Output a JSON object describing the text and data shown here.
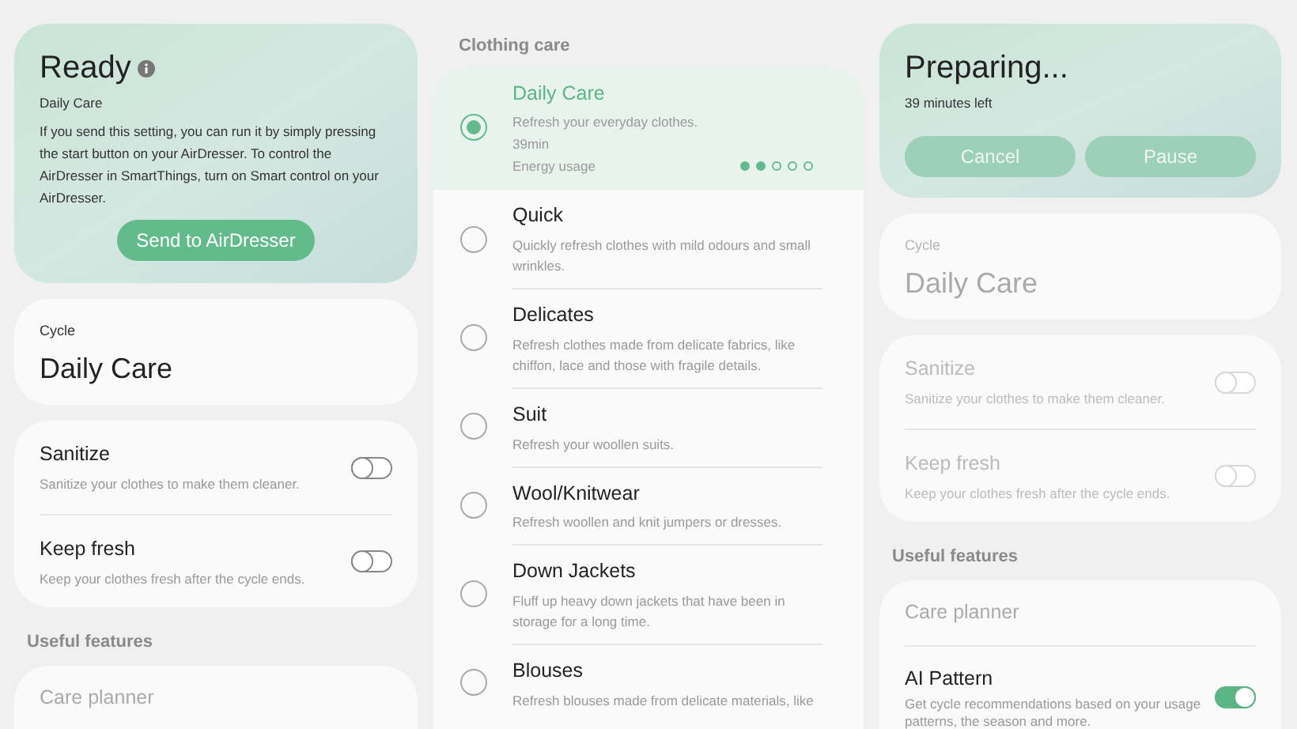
{
  "left": {
    "status": {
      "title": "Ready",
      "subtitle": "Daily Care",
      "message": "If you send this setting, you can run it by simply pressing the start button on your AirDresser. To control the AirDresser in SmartThings, turn on Smart control on your AirDresser.",
      "buttons": [
        "Send to AirDresser"
      ]
    },
    "cycle": {
      "label": "Cycle",
      "value": "Daily Care",
      "disabled": false
    },
    "options": [
      {
        "title": "Sanitize",
        "description": "Sanitize your clothes to make them cleaner.",
        "on": false,
        "disabled": false
      },
      {
        "title": "Keep fresh",
        "description": "Keep your clothes fresh after the cycle ends.",
        "on": false,
        "disabled": false
      }
    ],
    "section_title": "Useful features",
    "features": [
      {
        "kind": "link",
        "title": "Care planner",
        "disabled": true
      }
    ]
  },
  "middle": {
    "section_title": "Clothing care",
    "cycles": [
      {
        "title": "Daily Care",
        "description": "Refresh your everyday clothes.",
        "duration": "39min",
        "energy_label": "Energy usage",
        "stars": 2,
        "selected": true
      },
      {
        "title": "Quick",
        "description": "Quickly refresh clothes with mild odours and small wrinkles.",
        "selected": false
      },
      {
        "title": "Delicates",
        "description": "Refresh clothes made from delicate fabrics, like chiffon, lace and those with fragile details.",
        "selected": false
      },
      {
        "title": "Suit",
        "description": "Refresh your woollen suits.",
        "selected": false
      },
      {
        "title": "Wool/Knitwear",
        "description": "Refresh woollen and knit jumpers or dresses.",
        "selected": false
      },
      {
        "title": "Down Jackets",
        "description": "Fluff up heavy down jackets that have been in storage for a long time.",
        "selected": false
      },
      {
        "title": "Blouses",
        "description": "Refresh blouses made from delicate materials, like",
        "selected": false
      }
    ]
  },
  "right": {
    "status": {
      "title": "Preparing...",
      "subtitle": "39 minutes left",
      "buttons": [
        "Cancel",
        "Pause"
      ]
    },
    "cycle": {
      "label": "Cycle",
      "value": "Daily Care",
      "disabled": true
    },
    "options": [
      {
        "title": "Sanitize",
        "description": "Sanitize your clothes to make them cleaner.",
        "on": false,
        "disabled": true
      },
      {
        "title": "Keep fresh",
        "description": "Keep your clothes fresh after the cycle ends.",
        "on": false,
        "disabled": true
      }
    ],
    "section_title": "Useful features",
    "features": [
      {
        "kind": "link",
        "title": "Care planner",
        "disabled": true
      },
      {
        "kind": "toggle",
        "title": "AI Pattern",
        "description": "Get cycle recommendations based on your usage patterns, the season and more.",
        "on": true,
        "disabled": false
      }
    ]
  }
}
